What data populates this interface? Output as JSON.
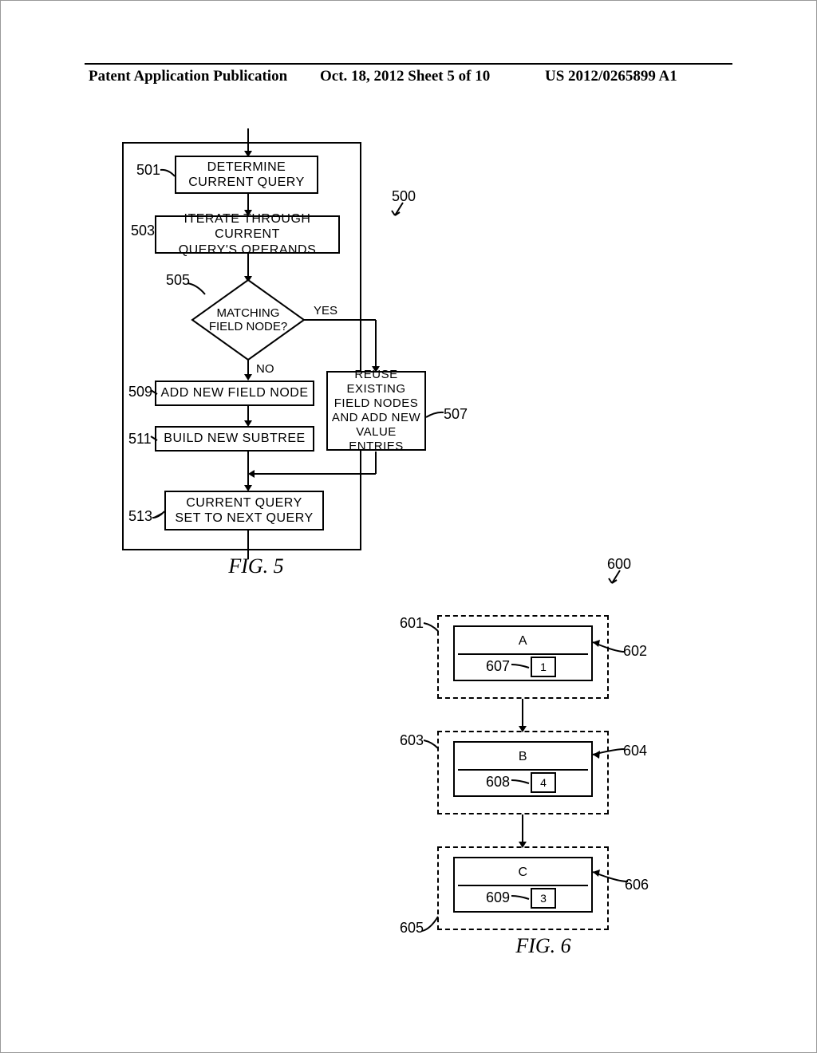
{
  "header": {
    "left": "Patent Application Publication",
    "mid": "Oct. 18, 2012  Sheet 5 of 10",
    "right": "US 2012/0265899 A1"
  },
  "flowchart500": {
    "ref": "500",
    "steps": {
      "s501": {
        "ref": "501",
        "text": "DETERMINE\nCURRENT QUERY"
      },
      "s503": {
        "ref": "503",
        "text": "ITERATE THROUGH CURRENT\nQUERY'S OPERANDS"
      },
      "s505": {
        "ref": "505",
        "text": "MATCHING\nFIELD NODE?",
        "yes": "YES",
        "no": "NO"
      },
      "s507": {
        "ref": "507",
        "text": "REUSE EXISTING\nFIELD NODES\nAND ADD NEW\nVALUE ENTRIES"
      },
      "s509": {
        "ref": "509",
        "text": "ADD NEW FIELD NODE"
      },
      "s511": {
        "ref": "511",
        "text": "BUILD NEW SUBTREE"
      },
      "s513": {
        "ref": "513",
        "text": "CURRENT QUERY\nSET TO NEXT QUERY"
      }
    },
    "caption": "FIG. 5"
  },
  "structure600": {
    "ref": "600",
    "nodes": {
      "n601": {
        "ref": "601",
        "ref_inner": "602",
        "label": "A",
        "val_ref": "607",
        "val": "1"
      },
      "n603": {
        "ref": "603",
        "ref_inner": "604",
        "label": "B",
        "val_ref": "608",
        "val": "4"
      },
      "n605": {
        "ref": "605",
        "ref_inner": "606",
        "label": "C",
        "val_ref": "609",
        "val": "3"
      }
    },
    "caption": "FIG. 6"
  }
}
